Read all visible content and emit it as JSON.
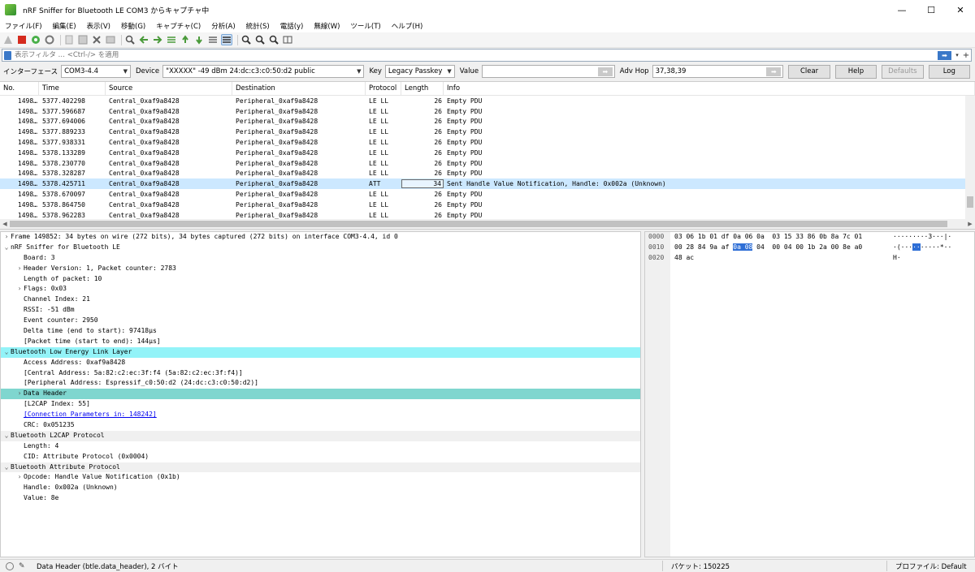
{
  "window": {
    "title": "nRF Sniffer for Bluetooth LE COM3 からキャプチャ中",
    "controls": [
      "—",
      "☐",
      "✕"
    ]
  },
  "menu": [
    "ファイル(F)",
    "編集(E)",
    "表示(V)",
    "移動(G)",
    "キャプチャ(C)",
    "分析(A)",
    "統計(S)",
    "電話(y)",
    "無線(W)",
    "ツール(T)",
    "ヘルプ(H)"
  ],
  "filter": {
    "placeholder": "表示フィルタ … <Ctrl-/> を適用",
    "apply_arrow": "➡",
    "dropdown": "▾",
    "plus": "+"
  },
  "interface_bar": {
    "interface_label": "インターフェース",
    "interface_value": "COM3-4.4",
    "device_label": "Device",
    "device_value": "\"XXXXX\"  -49 dBm  24:dc:c3:c0:50:d2  public",
    "key_label": "Key",
    "key_value": "Legacy Passkey",
    "value_label": "Value",
    "value_value": "",
    "adv_hop_label": "Adv Hop",
    "adv_hop_value": "37,38,39",
    "buttons": {
      "clear": "Clear",
      "help": "Help",
      "defaults": "Defaults",
      "log": "Log"
    }
  },
  "packet_list": {
    "columns": [
      "No.",
      "Time",
      "Source",
      "Destination",
      "Protocol",
      "Length",
      "Info"
    ],
    "rows": [
      {
        "no": "1498…",
        "time": "5377.402298",
        "src": "Central_0xaf9a8428",
        "dst": "Peripheral_0xaf9a8428",
        "proto": "LE LL",
        "len": "26",
        "info": "Empty PDU"
      },
      {
        "no": "1498…",
        "time": "5377.596687",
        "src": "Central_0xaf9a8428",
        "dst": "Peripheral_0xaf9a8428",
        "proto": "LE LL",
        "len": "26",
        "info": "Empty PDU"
      },
      {
        "no": "1498…",
        "time": "5377.694006",
        "src": "Central_0xaf9a8428",
        "dst": "Peripheral_0xaf9a8428",
        "proto": "LE LL",
        "len": "26",
        "info": "Empty PDU"
      },
      {
        "no": "1498…",
        "time": "5377.889233",
        "src": "Central_0xaf9a8428",
        "dst": "Peripheral_0xaf9a8428",
        "proto": "LE LL",
        "len": "26",
        "info": "Empty PDU"
      },
      {
        "no": "1498…",
        "time": "5377.938331",
        "src": "Central_0xaf9a8428",
        "dst": "Peripheral_0xaf9a8428",
        "proto": "LE LL",
        "len": "26",
        "info": "Empty PDU"
      },
      {
        "no": "1498…",
        "time": "5378.133289",
        "src": "Central_0xaf9a8428",
        "dst": "Peripheral_0xaf9a8428",
        "proto": "LE LL",
        "len": "26",
        "info": "Empty PDU"
      },
      {
        "no": "1498…",
        "time": "5378.230770",
        "src": "Central_0xaf9a8428",
        "dst": "Peripheral_0xaf9a8428",
        "proto": "LE LL",
        "len": "26",
        "info": "Empty PDU"
      },
      {
        "no": "1498…",
        "time": "5378.328287",
        "src": "Central_0xaf9a8428",
        "dst": "Peripheral_0xaf9a8428",
        "proto": "LE LL",
        "len": "26",
        "info": "Empty PDU"
      },
      {
        "no": "1498…",
        "time": "5378.425711",
        "src": "Central_0xaf9a8428",
        "dst": "Peripheral_0xaf9a8428",
        "proto": "ATT",
        "len": "34",
        "info": "Sent Handle Value Notification, Handle: 0x002a (Unknown)",
        "selected": true
      },
      {
        "no": "1498…",
        "time": "5378.670097",
        "src": "Central_0xaf9a8428",
        "dst": "Peripheral_0xaf9a8428",
        "proto": "LE LL",
        "len": "26",
        "info": "Empty PDU"
      },
      {
        "no": "1498…",
        "time": "5378.864750",
        "src": "Central_0xaf9a8428",
        "dst": "Peripheral_0xaf9a8428",
        "proto": "LE LL",
        "len": "26",
        "info": "Empty PDU"
      },
      {
        "no": "1498…",
        "time": "5378.962283",
        "src": "Central_0xaf9a8428",
        "dst": "Peripheral_0xaf9a8428",
        "proto": "LE LL",
        "len": "26",
        "info": "Empty PDU"
      }
    ]
  },
  "details": [
    {
      "indent": 0,
      "arrow": "›",
      "text": "Frame 149852: 34 bytes on wire (272 bits), 34 bytes captured (272 bits) on interface COM3-4.4, id 0"
    },
    {
      "indent": 0,
      "arrow": "⌄",
      "text": "nRF Sniffer for Bluetooth LE"
    },
    {
      "indent": 1,
      "arrow": "",
      "text": "Board: 3"
    },
    {
      "indent": 1,
      "arrow": "›",
      "text": "Header Version: 1, Packet counter: 2783"
    },
    {
      "indent": 1,
      "arrow": "",
      "text": "Length of packet: 10"
    },
    {
      "indent": 1,
      "arrow": "›",
      "text": "Flags: 0x03"
    },
    {
      "indent": 1,
      "arrow": "",
      "text": "Channel Index: 21"
    },
    {
      "indent": 1,
      "arrow": "",
      "text": "RSSI: -51 dBm"
    },
    {
      "indent": 1,
      "arrow": "",
      "text": "Event counter: 2950"
    },
    {
      "indent": 1,
      "arrow": "",
      "text": "Delta time (end to start): 97418µs"
    },
    {
      "indent": 1,
      "arrow": "",
      "text": "[Packet time (start to end): 144µs]"
    },
    {
      "indent": 0,
      "arrow": "⌄",
      "text": "Bluetooth Low Energy Link Layer",
      "hl": "cyan"
    },
    {
      "indent": 1,
      "arrow": "",
      "text": "Access Address: 0xaf9a8428"
    },
    {
      "indent": 1,
      "arrow": "",
      "text": "[Central Address: 5a:82:c2:ec:3f:f4 (5a:82:c2:ec:3f:f4)]"
    },
    {
      "indent": 1,
      "arrow": "",
      "text": "[Peripheral Address: Espressif_c0:50:d2 (24:dc:c3:c0:50:d2)]"
    },
    {
      "indent": 1,
      "arrow": "›",
      "text": "Data Header",
      "hl": "teal"
    },
    {
      "indent": 1,
      "arrow": "",
      "text": "[L2CAP Index: 55]"
    },
    {
      "indent": 1,
      "arrow": "",
      "text": "[Connection Parameters in: 148242]",
      "link": true
    },
    {
      "indent": 1,
      "arrow": "",
      "text": "CRC: 0x051235"
    },
    {
      "indent": 0,
      "arrow": "⌄",
      "text": "Bluetooth L2CAP Protocol",
      "hl": "gray"
    },
    {
      "indent": 1,
      "arrow": "",
      "text": "Length: 4"
    },
    {
      "indent": 1,
      "arrow": "",
      "text": "CID: Attribute Protocol (0x0004)"
    },
    {
      "indent": 0,
      "arrow": "⌄",
      "text": "Bluetooth Attribute Protocol",
      "hl": "gray"
    },
    {
      "indent": 1,
      "arrow": "›",
      "text": "Opcode: Handle Value Notification (0x1b)"
    },
    {
      "indent": 1,
      "arrow": "",
      "text": "Handle: 0x002a (Unknown)"
    },
    {
      "indent": 1,
      "arrow": "",
      "text": "Value: 8e"
    }
  ],
  "bytes": [
    {
      "offset": "0000",
      "hex_a": "03 06 1b 01 df 0a 06 0a  03 15 33 86 0b 8a 7c 01",
      "hex_sel": "",
      "hex_b": "",
      "ascii_a": "·········3···|·",
      "ascii_sel": "",
      "ascii_b": ""
    },
    {
      "offset": "0010",
      "hex_a": "00 28 84 9a af ",
      "hex_sel": "0a 08",
      "hex_b": " 04  00 04 00 1b 2a 00 8e a0",
      "ascii_a": "·(···",
      "ascii_sel": "··",
      "ascii_b": "·····*··"
    },
    {
      "offset": "0020",
      "hex_a": "48 ac",
      "hex_sel": "",
      "hex_b": "",
      "ascii_a": "H·",
      "ascii_sel": "",
      "ascii_b": ""
    }
  ],
  "status": {
    "field": "Data Header (btle.data_header), 2 バイト",
    "packets": "パケット: 150225",
    "profile": "プロファイル: Default"
  },
  "colors": {
    "selected_row": "#cce8ff",
    "highlight_cyan": "#93f3f8",
    "highlight_teal": "#7fd6cf",
    "byte_selection": "#2f6fd6"
  }
}
